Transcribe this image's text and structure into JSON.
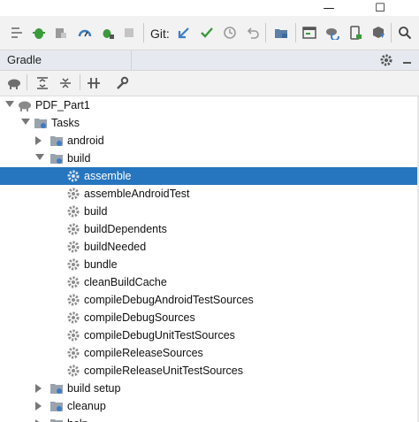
{
  "window": {
    "minimize": "—",
    "maximize": "☐",
    "close": "✕"
  },
  "toolbar": {
    "git_label": "Git:",
    "icons": [
      "build-make-icon",
      "debug-bug-icon",
      "attach-debugger-icon",
      "profile-icon",
      "apply-changes-icon",
      "stop-icon",
      "git-update-icon",
      "git-commit-icon",
      "git-history-icon",
      "git-rollback-icon",
      "project-structure-icon",
      "sync-gradle-icon",
      "avd-manager-icon",
      "sdk-manager-icon",
      "search-icon"
    ]
  },
  "panel": {
    "title": "Gradle"
  },
  "tree": {
    "project": "PDF_Part1",
    "tasks_label": "Tasks",
    "groups_before": [
      "android"
    ],
    "build_label": "build",
    "build_tasks": [
      "assemble",
      "assembleAndroidTest",
      "build",
      "buildDependents",
      "buildNeeded",
      "bundle",
      "cleanBuildCache",
      "compileDebugAndroidTestSources",
      "compileDebugSources",
      "compileDebugUnitTestSources",
      "compileReleaseSources",
      "compileReleaseUnitTestSources"
    ],
    "groups_after": [
      "build setup",
      "cleanup",
      "help"
    ],
    "selected": "assemble"
  },
  "colors": {
    "selection": "#2675bf",
    "accent_blue": "#3d7cc9",
    "green": "#3b9a3b"
  }
}
